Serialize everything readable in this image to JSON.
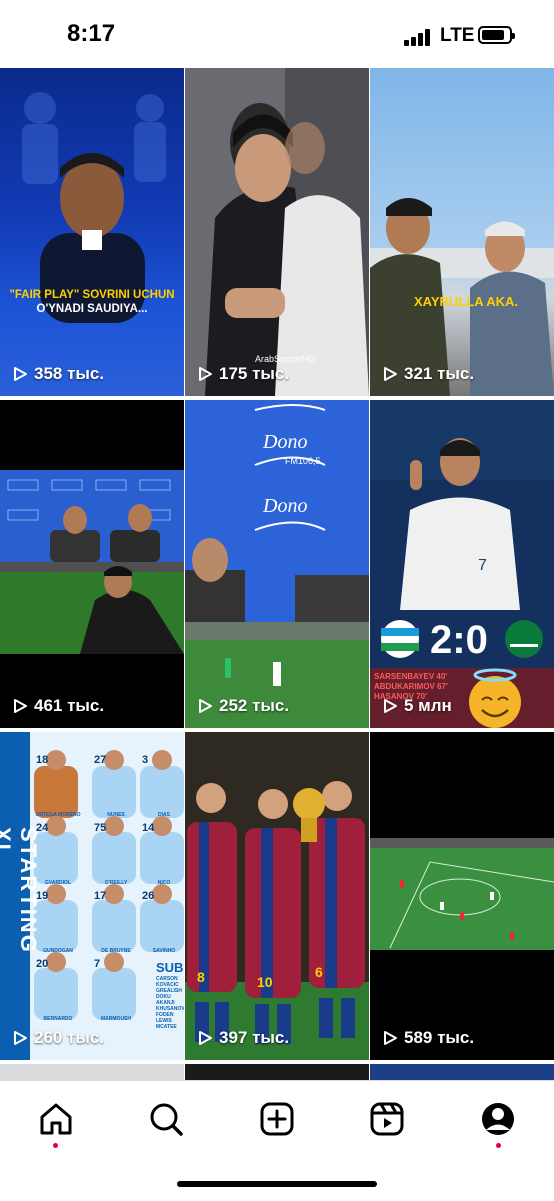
{
  "status_bar": {
    "time": "8:17",
    "network": "LTE"
  },
  "tiles": [
    {
      "views": "358 тыс.",
      "caption_line1": "\"FAIR PLAY\" SOVRINI UCHUN",
      "caption_line2": "O'YNADI SAUDIYA..."
    },
    {
      "views": "175 тыс.",
      "watermark": "ArabSoccerHD"
    },
    {
      "views": "321 тыс.",
      "caption": "XAYRULLA AKA."
    },
    {
      "views": "461 тыс."
    },
    {
      "views": "252 тыс.",
      "logo_text": "Dono",
      "logo_sub": "FM106,5"
    },
    {
      "views": "5 млн",
      "score": "2:0",
      "scorer1": "SARSENBAYEV 40'",
      "scorer2": "ABDUKARIMOV 67'",
      "scorer3": "HASANOV 70'",
      "shirt": "7"
    },
    {
      "views": "260 тыс.",
      "vertical_text": "STARTING XI",
      "subs_title": "SUBS",
      "subs": [
        "CARSON",
        "KOVACIC",
        "GREALISH",
        "DOKU",
        "AKANJI",
        "KHUSANOV",
        "FODEN",
        "LEWIS",
        "MCATEE"
      ],
      "players": [
        {
          "no": "18",
          "name": "ORTEGA MORENO"
        },
        {
          "no": "27",
          "name": "NUNES"
        },
        {
          "no": "3",
          "name": "DIAS"
        },
        {
          "no": "24",
          "name": "GVARDIOL"
        },
        {
          "no": "75",
          "name": "O'REILLY"
        },
        {
          "no": "14",
          "name": "NICO"
        },
        {
          "no": "19",
          "name": "GUNDOGAN"
        },
        {
          "no": "17",
          "name": "DE BRUYNE"
        },
        {
          "no": "26",
          "name": "SAVINHO"
        },
        {
          "no": "20",
          "name": "BERNARDO"
        },
        {
          "no": "7",
          "name": "MARMOUSH"
        }
      ]
    },
    {
      "views": "397 тыс.",
      "shirt1": "8",
      "shirt2": "10",
      "shirt3": "6"
    },
    {
      "views": "589 тыс."
    }
  ],
  "nav": {
    "items": [
      {
        "icon": "home-icon",
        "active": true
      },
      {
        "icon": "search-icon"
      },
      {
        "icon": "create-icon"
      },
      {
        "icon": "reels-icon"
      },
      {
        "icon": "profile-icon",
        "notification": true
      }
    ]
  },
  "colors": {
    "notification": "#e4003b",
    "caption": "#ffd000"
  }
}
